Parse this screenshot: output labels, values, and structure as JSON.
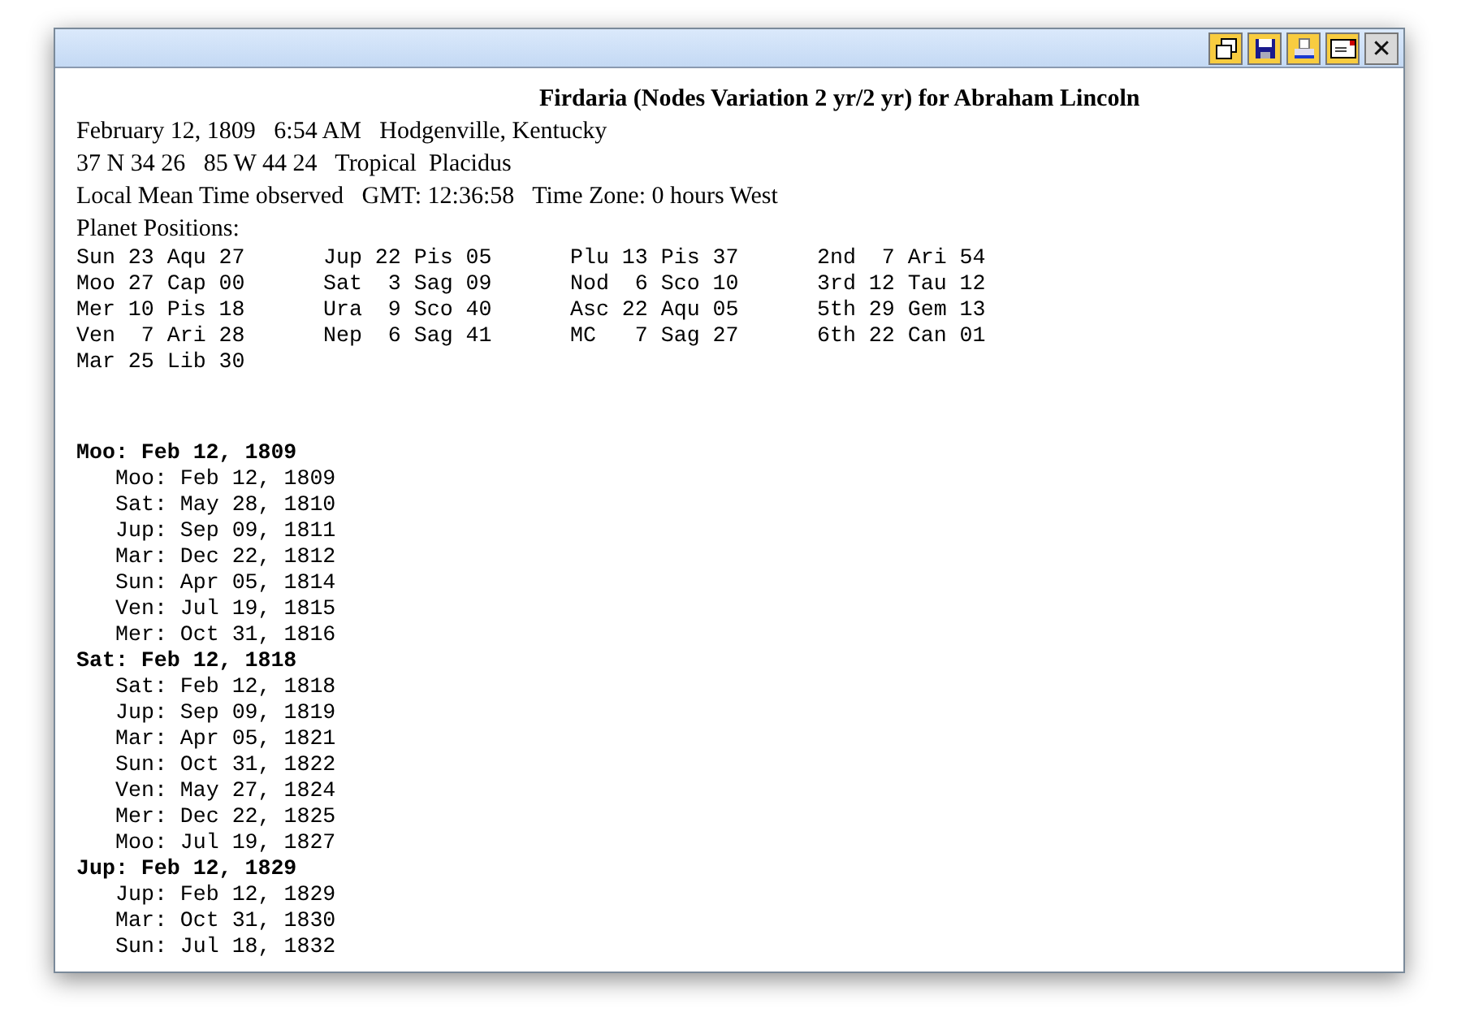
{
  "toolbar": [
    {
      "kind": "restore"
    },
    {
      "kind": "save"
    },
    {
      "kind": "print"
    },
    {
      "kind": "mail"
    },
    {
      "kind": "close",
      "label": "✕"
    }
  ],
  "report": {
    "title": "Firdaria (Nodes Variation 2 yr/2 yr) for Abraham Lincoln",
    "info_lines": [
      "February 12, 1809   6:54 AM   Hodgenville, Kentucky",
      "37 N 34 26   85 W 44 24   Tropical  Placidus",
      "Local Mean Time observed   GMT: 12:36:58   Time Zone: 0 hours West"
    ],
    "positions_heading": "Planet Positions:",
    "positions": [
      [
        "Sun 23 Aqu 27",
        "Moo 27 Cap 00",
        "Mer 10 Pis 18",
        "Ven  7 Ari 28",
        "Mar 25 Lib 30"
      ],
      [
        "Jup 22 Pis 05",
        "Sat  3 Sag 09",
        "Ura  9 Sco 40",
        "Nep  6 Sag 41"
      ],
      [
        "Plu 13 Pis 37",
        "Nod  6 Sco 10",
        "Asc 22 Aqu 05",
        "MC   7 Sag 27"
      ],
      [
        "2nd  7 Ari 54",
        "3rd 12 Tau 12",
        "5th 29 Gem 13",
        "6th 22 Can 01"
      ]
    ],
    "periods": [
      {
        "text": "Moo: Feb 12, 1809",
        "children": [
          {
            "text": "Moo: Feb 12, 1809"
          },
          {
            "text": "Sat: May 28, 1810"
          },
          {
            "text": "Jup: Sep 09, 1811"
          },
          {
            "text": "Mar: Dec 22, 1812"
          },
          {
            "text": "Sun: Apr 05, 1814"
          },
          {
            "text": "Ven: Jul 19, 1815"
          },
          {
            "text": "Mer: Oct 31, 1816"
          }
        ]
      },
      {
        "text": "Sat: Feb 12, 1818",
        "children": [
          {
            "text": "Sat: Feb 12, 1818"
          },
          {
            "text": "Jup: Sep 09, 1819"
          },
          {
            "text": "Mar: Apr 05, 1821"
          },
          {
            "text": "Sun: Oct 31, 1822"
          },
          {
            "text": "Ven: May 27, 1824"
          },
          {
            "text": "Mer: Dec 22, 1825"
          },
          {
            "text": "Moo: Jul 19, 1827"
          }
        ]
      },
      {
        "text": "Jup: Feb 12, 1829",
        "children": [
          {
            "text": "Jup: Feb 12, 1829"
          },
          {
            "text": "Mar: Oct 31, 1830"
          },
          {
            "text": "Sun: Jul 18, 1832"
          }
        ]
      }
    ]
  }
}
